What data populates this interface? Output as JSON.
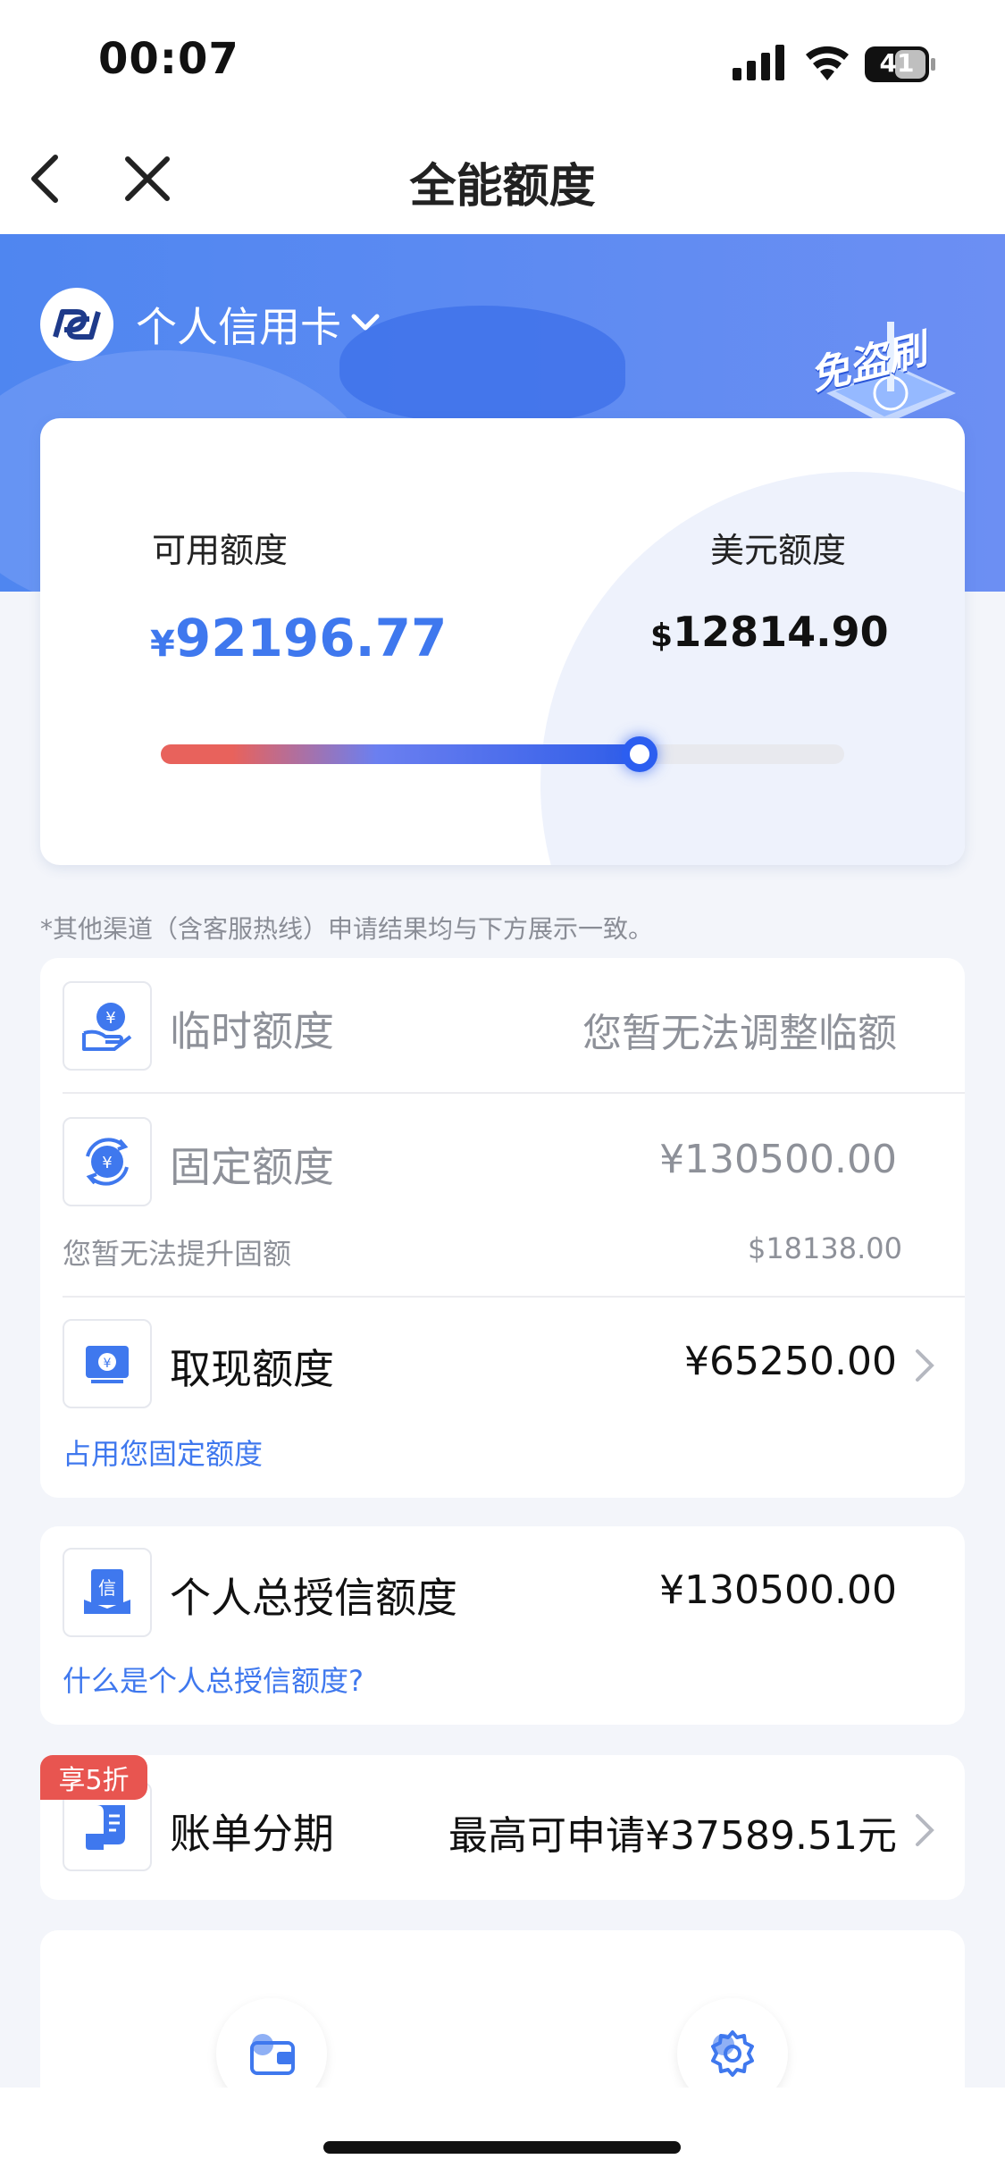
{
  "status_bar": {
    "time": "00:07",
    "battery": "41"
  },
  "nav": {
    "title": "全能额度"
  },
  "banner": {
    "card_type": "个人信用卡",
    "badge_text": "免盗刷"
  },
  "quota": {
    "available_label": "可用额度",
    "available_currency": "¥",
    "available_amount": "92196.77",
    "usd_label": "美元额度",
    "usd_currency": "$",
    "usd_amount": "12814.90",
    "usage_percent": 70
  },
  "notice": "*其他渠道（含客服热线）申请结果均与下方展示一致。",
  "limits": {
    "temporary": {
      "title": "临时额度",
      "value": "您暂无法调整临额"
    },
    "fixed": {
      "title": "固定额度",
      "value": "¥130500.00",
      "sub_left": "您暂无法提升固额",
      "sub_right": "$18138.00"
    },
    "cash": {
      "title": "取现额度",
      "value": "¥65250.00",
      "sub": "占用您固定额度"
    }
  },
  "total_credit": {
    "title": "个人总授信额度",
    "value": "¥130500.00",
    "link": "什么是个人总授信额度?"
  },
  "installment": {
    "badge": "享5折",
    "title": "账单分期",
    "value": "最高可申请¥37589.51元"
  },
  "icons": {
    "temporary": "hand-yen-icon",
    "fixed": "exchange-yen-icon",
    "cash": "cash-withdraw-icon",
    "total": "credit-document-icon",
    "installment": "bill-installment-icon"
  },
  "colors": {
    "accent": "#3f78ee",
    "badge": "#e85550",
    "slider_start": "#e8625c",
    "slider_end": "#2f5de8"
  }
}
